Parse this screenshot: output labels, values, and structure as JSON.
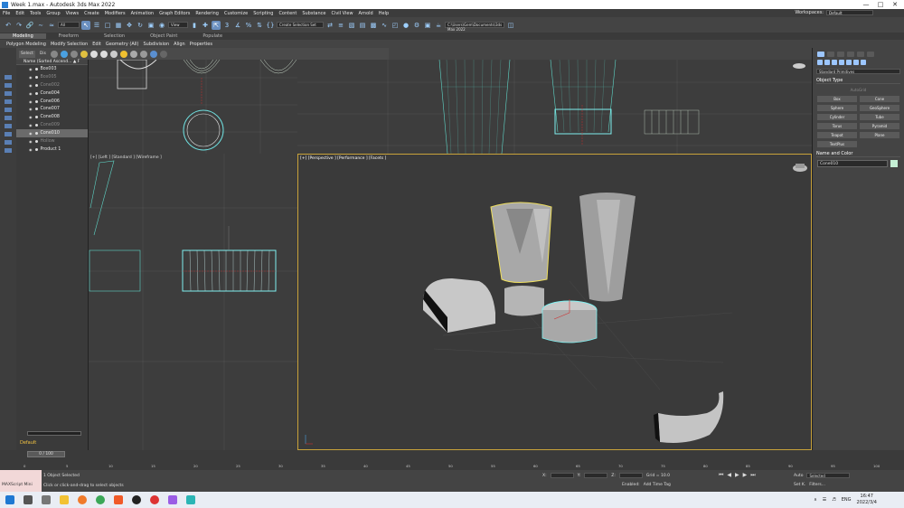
{
  "window": {
    "title": "Week 1.max - Autodesk 3ds Max 2022"
  },
  "menu": [
    "File",
    "Edit",
    "Tools",
    "Group",
    "Views",
    "Create",
    "Modifiers",
    "Animation",
    "Graph Editors",
    "Rendering",
    "Customize",
    "Scripting",
    "Content",
    "Substance",
    "Civil View",
    "Arnold",
    "Help"
  ],
  "workspace": {
    "label": "Workspaces:",
    "value": "Default"
  },
  "toolbar": {
    "filter": "All",
    "view": "View",
    "selection_set": "Create Selection Set",
    "path": "C:\\Users\\Gem\\Documents\\3ds Max 2022"
  },
  "ribbon": {
    "tabs": [
      "Modeling",
      "Freeform",
      "Selection",
      "Object Paint",
      "Populate"
    ],
    "active_tab": "Modeling",
    "sub": [
      "Polygon Modeling",
      "Modify Selection",
      "Edit",
      "Geometry (All)",
      "Subdivision",
      "Align",
      "Properties"
    ]
  },
  "scene_tabs": [
    "Select",
    "Dis"
  ],
  "explorer": {
    "header": "Name (Sorted Ascend... ▲ F",
    "items": [
      {
        "name": "Box003",
        "dim": false,
        "sel": false
      },
      {
        "name": "Box005",
        "dim": true,
        "sel": false
      },
      {
        "name": "Cone002",
        "dim": true,
        "sel": false
      },
      {
        "name": "Cone004",
        "dim": false,
        "sel": false
      },
      {
        "name": "Cone006",
        "dim": false,
        "sel": false
      },
      {
        "name": "Cone007",
        "dim": false,
        "sel": false
      },
      {
        "name": "Cone008",
        "dim": false,
        "sel": false
      },
      {
        "name": "Cone009",
        "dim": true,
        "sel": false
      },
      {
        "name": "Cone010",
        "dim": false,
        "sel": true
      },
      {
        "name": "Hollow",
        "dim": true,
        "sel": false
      },
      {
        "name": "Product 1",
        "dim": false,
        "sel": false
      }
    ],
    "layer": "Default"
  },
  "viewports": {
    "left": "[+] [Left ] [Standard ] [Wireframe ]",
    "perspective": "[+] [Perspective ] [Performance ] [Facets ]"
  },
  "command_panel": {
    "dropdown": "Standard Primitives",
    "object_type_title": "Object Type",
    "autogrid": "AutoGrid",
    "buttons": [
      "Box",
      "Cone",
      "Sphere",
      "GeoSphere",
      "Cylinder",
      "Tube",
      "Torus",
      "Pyramid",
      "Teapot",
      "Plane",
      "TextPlus"
    ],
    "name_color_title": "Name and Color",
    "object_name": "Cone010",
    "object_color": "#c5f0d5"
  },
  "timeline": {
    "frame": "0 / 100",
    "ticks": [
      "0",
      "5",
      "10",
      "15",
      "20",
      "25",
      "30",
      "35",
      "40",
      "45",
      "50",
      "55",
      "60",
      "65",
      "70",
      "75",
      "80",
      "85",
      "90",
      "95",
      "100"
    ]
  },
  "status": {
    "maxscript": "MAXScript Mini",
    "selected": "1 Object Selected",
    "hint": "Click or click-and-drag to select objects",
    "x": "X:",
    "y": "Y:",
    "z": "Z:",
    "grid": "Grid = 10.0",
    "add_time_tag": "Add Time Tag",
    "enabled": "Enabled:",
    "auto": "Auto",
    "set_k": "Set K.",
    "selected_dd": "Selected",
    "filters": "Filters..."
  },
  "taskbar": {
    "lang": "ENG",
    "time": "16:47",
    "date": "2022/3/4"
  }
}
